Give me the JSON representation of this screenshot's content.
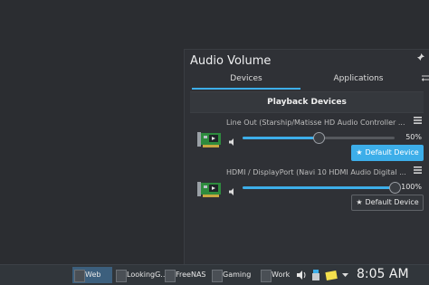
{
  "popup": {
    "title": "Audio Volume",
    "tabs": {
      "devices": "Devices",
      "applications": "Applications"
    },
    "section_header": "Playback Devices",
    "devices": [
      {
        "name": "Line Out (Starship/Matisse HD Audio Controller ...",
        "volume_percent": 50,
        "volume_label": "50%",
        "default_label": "Default Device",
        "is_default": true
      },
      {
        "name": "HDMI / DisplayPort (Navi 10 HDMI Audio Digital ...",
        "volume_percent": 100,
        "volume_label": "100%",
        "default_label": "Default Device",
        "is_default": false
      }
    ]
  },
  "taskbar": {
    "desktops": [
      "Web",
      "LookingG...",
      "FreeNAS",
      "Gaming",
      "Work"
    ],
    "active_desktop": "Web",
    "clock": "8:05 AM"
  },
  "icons": {
    "pin": "pin-icon",
    "configure": "configure-icon",
    "menu": "hamburger-menu-icon",
    "speaker": "speaker-icon",
    "sound_card": "sound-card-icon",
    "star": "star-icon"
  },
  "colors": {
    "accent": "#3daee9",
    "panel_bg": "#2f3136",
    "taskbar_bg": "#31363b"
  }
}
